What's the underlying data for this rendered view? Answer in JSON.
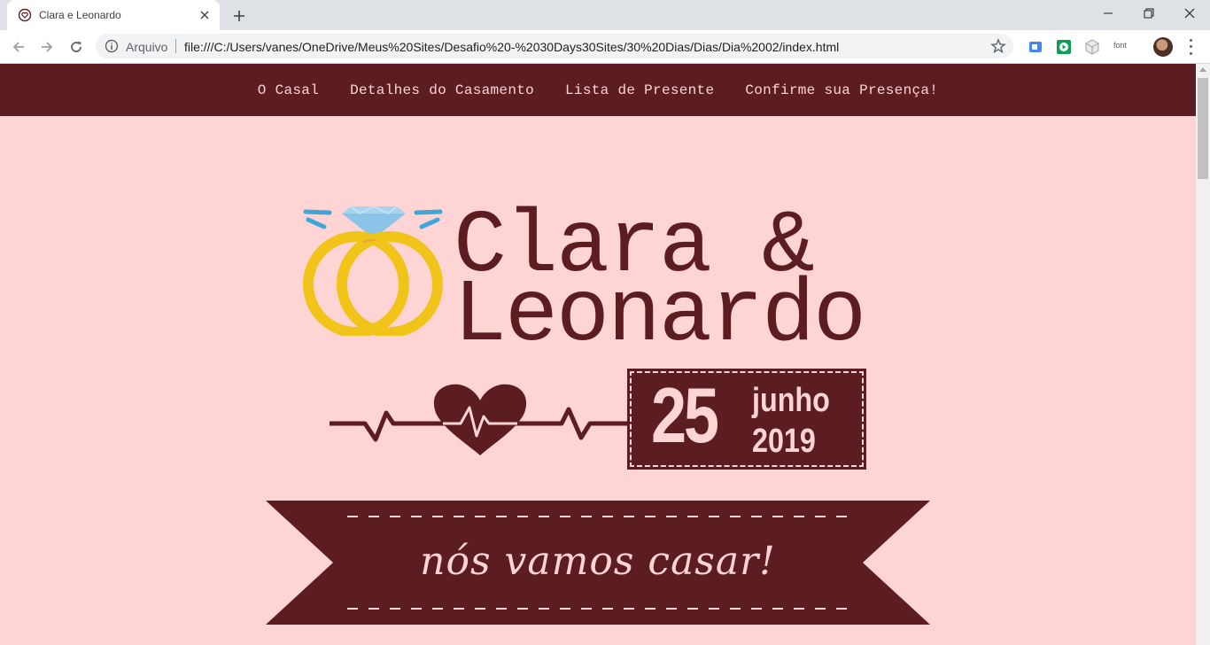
{
  "browser": {
    "tab_title": "Clara e Leonardo",
    "omnibox_scheme": "Arquivo",
    "url": "file:///C:/Users/vanes/OneDrive/Meus%20Sites/Desafio%20-%2030Days30Sites/30%20Dias/Dias/Dia%2002/index.html",
    "extension_font_label": "font"
  },
  "nav": {
    "items": [
      "O Casal",
      "Detalhes do Casamento",
      "Lista de Presente",
      "Confirme sua Presença!"
    ]
  },
  "hero": {
    "line1": "Clara &",
    "line2": "Leonardo",
    "date_day": "25",
    "date_month": "junho",
    "date_year": "2019",
    "banner_text": "nós vamos casar!"
  },
  "colors": {
    "page_bg": "#ffd4d4",
    "wine": "#5b1c22",
    "gold": "#f0c419",
    "diamond": "#a8d4f0",
    "sparkle": "#3ea6d8"
  }
}
